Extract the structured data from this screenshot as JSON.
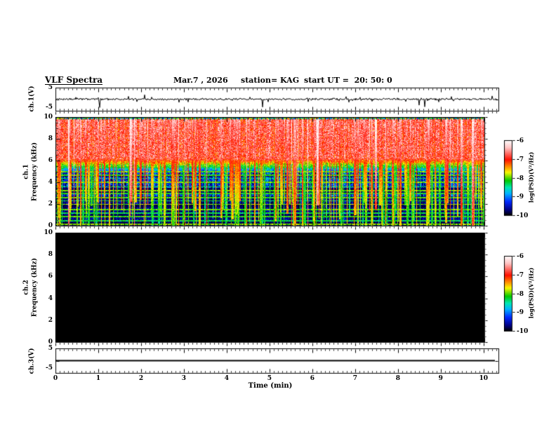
{
  "header": {
    "title": "VLF Spectra",
    "date": "Mar.7 , 2026",
    "station": "station= KAG",
    "start_ut": "start UT =  20: 50: 0"
  },
  "xaxis": {
    "label": "Time (min)",
    "min": 0,
    "max": 10,
    "tick_labels": [
      "0",
      "1",
      "2",
      "3",
      "4",
      "5",
      "6",
      "7",
      "8",
      "9",
      "10"
    ],
    "minor_step": 0.1
  },
  "colorbar": {
    "label": "log(PSD)(V²/Hz)",
    "tick_labels": [
      "-6",
      "-7",
      "-8",
      "-9",
      "-10"
    ],
    "max": -6,
    "min": -10,
    "stops": [
      [
        "#ffffff",
        0
      ],
      [
        "#ffc4c4",
        0.1
      ],
      [
        "#ff1000",
        0.26
      ],
      [
        "#ff9800",
        0.36
      ],
      [
        "#f8f800",
        0.43
      ],
      [
        "#00c800",
        0.54
      ],
      [
        "#00e8b0",
        0.63
      ],
      [
        "#00b4ff",
        0.71
      ],
      [
        "#0028ff",
        0.82
      ],
      [
        "#000080",
        0.93
      ],
      [
        "#000000",
        1.0
      ]
    ]
  },
  "panels": {
    "ch1_wave": {
      "ylabel": "ch.1(V)",
      "ytick_top": "5",
      "ytick_bottom": "-5",
      "ylim": [
        -5,
        5
      ]
    },
    "ch1_spec": {
      "channel_label": "ch.1",
      "ylabel": "Frequency (kHz)",
      "ytick_labels": [
        "10",
        "8",
        "6",
        "4",
        "2",
        "0"
      ],
      "ylim": [
        0,
        10
      ],
      "minor_step": 0.5
    },
    "ch2_spec": {
      "channel_label": "ch.2",
      "ylabel": "Frequency (kHz)",
      "ytick_labels": [
        "10",
        "8",
        "6",
        "4",
        "2",
        "0"
      ],
      "ylim": [
        0,
        10
      ],
      "minor_step": 0.5
    },
    "ch3_wave": {
      "ylabel": "ch.3(V)",
      "ytick_top": "5",
      "ytick_bottom": "-5",
      "ylim": [
        -5,
        5
      ]
    }
  },
  "chart_data": [
    {
      "type": "line",
      "name": "ch1_waveform",
      "panel": "ch1_wave",
      "xlim": [
        0,
        10.35
      ],
      "ylim": [
        -5,
        5
      ],
      "baseline_v": 0,
      "noise_v": 0.28,
      "spikes": [
        {
          "t": 1.03,
          "v": -3.6
        },
        {
          "t": 2.08,
          "v": 1.9
        },
        {
          "t": 3.1,
          "v": -1.2
        },
        {
          "t": 4.55,
          "v": 0.9
        },
        {
          "t": 4.83,
          "v": -3.4
        },
        {
          "t": 5.9,
          "v": -1.1
        },
        {
          "t": 6.85,
          "v": -1.3
        },
        {
          "t": 7.4,
          "v": -0.9
        },
        {
          "t": 8.5,
          "v": -2.6
        },
        {
          "t": 8.62,
          "v": -3.3
        },
        {
          "t": 9.3,
          "v": -0.8
        }
      ],
      "seed": 11,
      "description": "noisy signal around 0 V with sporadic impulsive spikes"
    },
    {
      "type": "heatmap",
      "name": "ch1_spectrogram",
      "panel": "ch1_spec",
      "xlim": [
        0,
        10
      ],
      "ylim": [
        0,
        10
      ],
      "psd_range": [
        -10,
        -6
      ],
      "background_bands": [
        {
          "f": [
            6.2,
            10
          ],
          "psd": -6.85,
          "noise": 0.5
        },
        {
          "f": [
            5.0,
            6.2
          ],
          "psd_gradient": [
            -9.2,
            -6.85
          ],
          "noise": 0.45
        },
        {
          "f": [
            2.75,
            5.0
          ],
          "psd": -9.35,
          "noise": 0.55
        },
        {
          "f": [
            0,
            2.75
          ],
          "psd": -9.7,
          "noise": 0.3
        }
      ],
      "dark_bands": [
        [
          0.0,
          0.42
        ],
        [
          0.88,
          1.08
        ],
        [
          1.68,
          1.95
        ],
        [
          3.05,
          3.5
        ],
        [
          4.52,
          4.72
        ]
      ],
      "narrowband_lines": [
        {
          "f": 0.15,
          "psd": -7.9
        },
        {
          "f": 0.5,
          "psd": -8.3
        },
        {
          "f": 0.85,
          "psd": -8.1
        },
        {
          "f": 1.18,
          "psd": -8.3
        },
        {
          "f": 1.52,
          "psd": -8.0
        },
        {
          "f": 2.0,
          "psd": -7.9
        },
        {
          "f": 2.32,
          "psd": -8.3
        },
        {
          "f": 2.62,
          "psd": -8.1
        },
        {
          "f": 3.0,
          "psd": -8.2
        },
        {
          "f": 3.28,
          "psd": -8.0
        },
        {
          "f": 3.62,
          "psd": -8.3
        },
        {
          "f": 4.05,
          "psd": -8.0
        },
        {
          "f": 4.38,
          "psd": -8.4
        },
        {
          "f": 4.68,
          "psd": -8.1
        },
        {
          "f": 5.02,
          "psd": -8.0
        },
        {
          "f": 5.45,
          "psd": -8.2
        },
        {
          "f": 5.75,
          "psd": -8.4
        }
      ],
      "vertical_streaks": {
        "count": 320,
        "red_frac": 0.55,
        "white_frac": 0.15,
        "green_frac": 0.3
      },
      "seed": 7,
      "description": "dense broadband bursts: white/red background above ~6 kHz, blue/black below ~5 kHz with narrowband horizontal lines and full-height red/green vertical streaks"
    },
    {
      "type": "heatmap",
      "name": "ch2_spectrogram",
      "panel": "ch2_spec",
      "xlim": [
        0,
        10
      ],
      "ylim": [
        0,
        10
      ],
      "psd_range": [
        -10,
        -6
      ],
      "uniform_psd": -10,
      "description": "no signal - uniform black (PSD at or below -10)"
    },
    {
      "type": "line",
      "name": "ch3_waveform",
      "panel": "ch3_wave",
      "xlim": [
        0,
        10.35
      ],
      "ylim": [
        -5,
        5
      ],
      "constant_v": 0,
      "description": "flat line at 0 V"
    }
  ]
}
